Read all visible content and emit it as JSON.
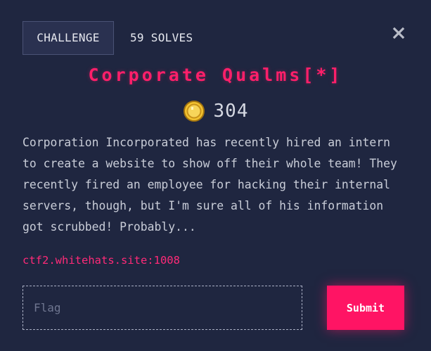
{
  "header": {
    "tab_challenge": "CHALLENGE",
    "tab_solves": "59 SOLVES"
  },
  "challenge": {
    "title": "Corporate Qualms[*]",
    "points": "304",
    "description": "Corporation Incorporated has recently hired an intern\nto create a website to show off their whole team! They\nrecently fired an employee for hacking their internal\nservers, though, but I'm sure all of his information\ngot scrubbed! Probably...",
    "link": "ctf2.whitehats.site:1008"
  },
  "form": {
    "flag_placeholder": "Flag",
    "flag_value": "",
    "submit_label": "Submit"
  },
  "icons": {
    "close": "close-icon",
    "coin": "coin-icon"
  },
  "colors": {
    "background": "#1f2640",
    "accent": "#ff1f6a",
    "coin": "#f2c230"
  }
}
